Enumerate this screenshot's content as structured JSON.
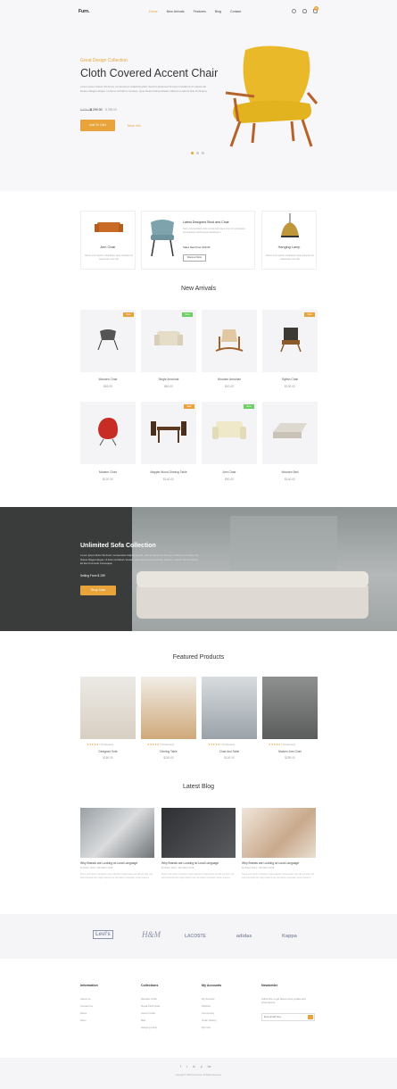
{
  "header": {
    "logo": "Furn.",
    "nav": [
      "Home",
      "New Arrivals",
      "Features",
      "Blog",
      "Contact"
    ],
    "cart_count": "0"
  },
  "hero": {
    "subtitle": "Great Design Collection",
    "title": "Cloth Covered Accent Chair",
    "description": "Lorem Ipsum Dolor Sit Amet, Consectetur Adipiscing Elit, Sed Do Eiusmod Tempor Incididunt Ut Labore Et Dolore Magna Aliqua. Ut Enim Ad Minim Veniam, Quis Nostrud Exercitation Ullamco Laboris Nisi Ut Aliquip.",
    "price_old": "$ 500.00",
    "price": "$ 299.00",
    "price_alt": "$ 399.00",
    "cart_label": "Add To Cart",
    "more_label": "More Info"
  },
  "categories": [
    {
      "name": "Arm Chair",
      "desc": "Nemo enim ipsam voluptatem quia voluptas sit aspernatur aut odit"
    },
    {
      "name": "Latest Designed Stool and Chair",
      "desc": "Sed ut perspiciatis unde omnis iste natus error sit voluptatem accusantium doloremque laudantium.",
      "sale": "Sales Start From $10.00",
      "button": "Discover More"
    },
    {
      "name": "Hanging Lamp",
      "desc": "Nemo enim ipsam voluptatem quia voluptas sit aspernatur aut odit"
    }
  ],
  "new_arrivals": {
    "title": "New Arrivals",
    "products": [
      {
        "name": "Wooden Chair",
        "price": "$65.00",
        "tag": "Sale",
        "tag_type": "sale"
      },
      {
        "name": "Single Armchair",
        "price": "$80.00",
        "tag": "New",
        "tag_type": "new"
      },
      {
        "name": "Wooden Armchair",
        "price": "$40.00",
        "tag": "",
        "tag_type": ""
      },
      {
        "name": "Stylish Chair",
        "price": "$100.00",
        "tag": "Sale",
        "tag_type": "sale"
      },
      {
        "name": "Modern Chair",
        "price": "$120.00",
        "tag": "",
        "tag_type": ""
      },
      {
        "name": "Mapple Wood Dinning Table",
        "price": "$140.00",
        "tag": "Sale",
        "tag_type": "sale"
      },
      {
        "name": "Arm Chair",
        "price": "$90.00",
        "tag": "New",
        "tag_type": "new"
      },
      {
        "name": "Wooden Bed",
        "price": "$140.00",
        "tag": "",
        "tag_type": ""
      }
    ]
  },
  "banner": {
    "title": "Unlimited Sofa Collection",
    "text": "Lorem Ipsum Dolor Sit Amet, Consectetur Adipisicing Elit, Sed Do Eiusmod Tempor Incididunt Ut Labore Et Dolore Magna Aliqua. Ut Enim Ad Minim Veniam, Quis Nostrud Exercitation Ullamco Laboris Nisi Ut Aliquip Ex Ea Commodo Consequat.",
    "price": "Selling From $ 199",
    "button": "Shop Now"
  },
  "featured": {
    "title": "Featured Products",
    "products": [
      {
        "name": "Designed Sofa",
        "price": "$160.00",
        "reviews": "(10 Review)"
      },
      {
        "name": "Dinning Table",
        "price": "$200.00",
        "reviews": "(10 Review)"
      },
      {
        "name": "Chair And Table",
        "price": "$100.00",
        "reviews": "(10 Review)"
      },
      {
        "name": "Modern Arm Chair",
        "price": "$299.00",
        "reviews": "(10 Review)"
      }
    ]
  },
  "blog": {
    "title": "Latest Blog",
    "posts": [
      {
        "title": "Why Brands are Looking at Local Language",
        "meta": "By Robert Norby / 18th March 2018",
        "text": "Nemo enim ipsam voluptatem quia voluptas sit aspernatur aut odit aut fugit, sed quia consequuntur magni dolores eos qui ratione voluptatem sequi nesciunt."
      },
      {
        "title": "Why Brands are Looking at Local Language",
        "meta": "By Robert Norby / 18th March 2018",
        "text": "Nemo enim ipsam voluptatem quia voluptas sit aspernatur aut odit aut fugit, sed quia consequuntur magni dolores eos qui ratione voluptatem sequi nesciunt."
      },
      {
        "title": "Why Brands are Looking at Local Language",
        "meta": "By Robert Norby / 18th March 2018",
        "text": "Nemo enim ipsam voluptatem quia voluptas sit aspernatur aut odit aut fugit, sed quia consequuntur magni dolores eos qui ratione voluptatem sequi nesciunt."
      }
    ]
  },
  "brands": [
    "Levi's",
    "H&M",
    "LACOSTE",
    "adidas",
    "Kappa"
  ],
  "footer": {
    "columns": [
      {
        "heading": "Information",
        "items": [
          "About Us",
          "Contact Us",
          "News",
          "Store"
        ]
      },
      {
        "heading": "Collections",
        "items": [
          "Wooden Chair",
          "Royal Cloth Sofa",
          "Accent Chair",
          "Bed",
          "Hanging Lamp"
        ]
      },
      {
        "heading": "My Accounts",
        "items": [
          "My Account",
          "Wishlist",
          "Community",
          "Order History",
          "My Cart"
        ]
      },
      {
        "heading": "Newsletter",
        "items": [
          "Subscribe to get latest news,update and informations."
        ]
      }
    ],
    "newsletter_placeholder": "Enter Email Here",
    "social": [
      "f",
      "t",
      "in",
      "p",
      "be"
    ],
    "copyright": "Copyright © 2018 Themesine. All Rights Reserved."
  }
}
